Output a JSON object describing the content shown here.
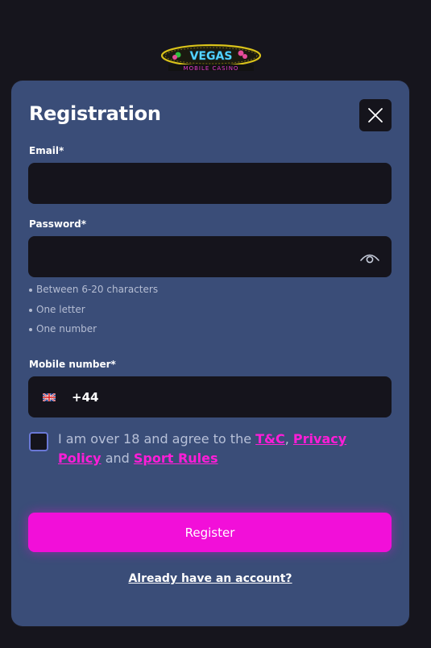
{
  "brand": {
    "logo_text": "VEGAS",
    "logo_subtext": "MOBILE CASINO",
    "icon": "vegas-logo-icon"
  },
  "modal": {
    "title": "Registration",
    "close_icon": "close-icon"
  },
  "form": {
    "email": {
      "label": "Email*",
      "value": "",
      "placeholder": ""
    },
    "password": {
      "label": "Password*",
      "value": "",
      "placeholder": "",
      "toggle_icon": "eye-icon",
      "hints": [
        "Between 6-20 characters",
        "One letter",
        "One number"
      ]
    },
    "mobile": {
      "label": "Mobile number*",
      "country_icon": "uk-flag-icon",
      "prefix": "+44",
      "value": ""
    },
    "consent": {
      "checked": false,
      "text_before": "I am over 18 and agree to the ",
      "link_tc": "T&C",
      "sep1": ", ",
      "link_privacy": "Privacy Policy",
      "sep2": " and ",
      "link_sport": "Sport Rules"
    },
    "register_label": "Register",
    "login_link": "Already have an account?"
  },
  "colors": {
    "background": "#16151d",
    "modal": "#3a4d78",
    "field": "#15141c",
    "accent": "#f20fd9",
    "link": "#ff1dd8"
  }
}
